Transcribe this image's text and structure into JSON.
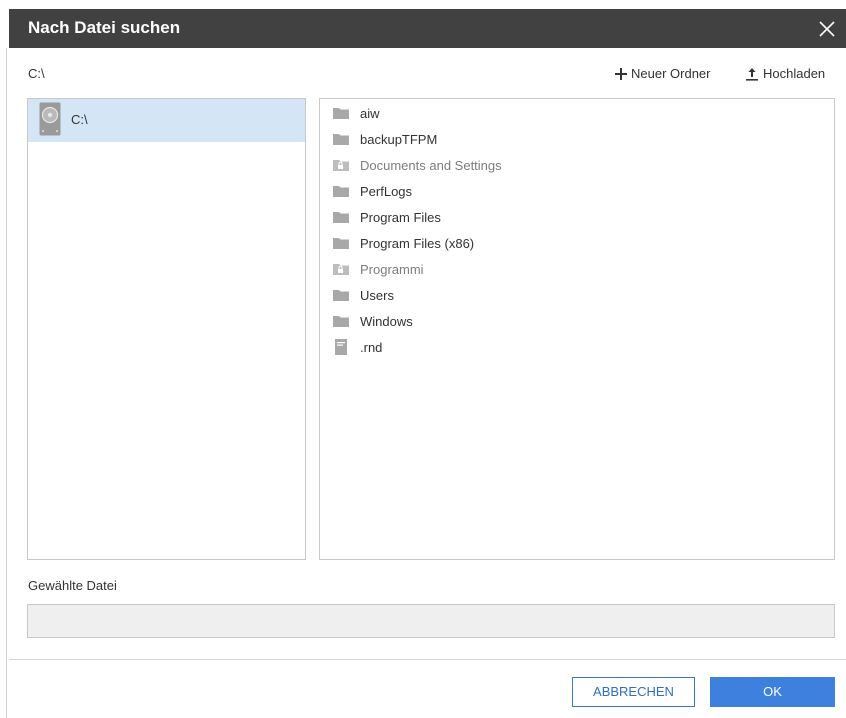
{
  "dialog": {
    "title": "Nach Datei suchen"
  },
  "toolbar": {
    "current_path": "C:\\",
    "new_folder_label": "Neuer Ordner",
    "upload_label": "Hochladen"
  },
  "tree": {
    "items": [
      {
        "label": "C:\\",
        "icon": "drive-icon",
        "selected": true
      }
    ]
  },
  "files": [
    {
      "name": "aiw",
      "icon": "folder-icon",
      "locked": false
    },
    {
      "name": "backupTFPM",
      "icon": "folder-icon",
      "locked": false
    },
    {
      "name": "Documents and Settings",
      "icon": "locked-folder-icon",
      "locked": true
    },
    {
      "name": "PerfLogs",
      "icon": "folder-icon",
      "locked": false
    },
    {
      "name": "Program Files",
      "icon": "folder-icon",
      "locked": false
    },
    {
      "name": "Program Files (x86)",
      "icon": "folder-icon",
      "locked": false
    },
    {
      "name": "Programmi",
      "icon": "locked-folder-icon",
      "locked": true
    },
    {
      "name": "Users",
      "icon": "folder-icon",
      "locked": false
    },
    {
      "name": "Windows",
      "icon": "folder-icon",
      "locked": false
    },
    {
      "name": ".rnd",
      "icon": "file-icon",
      "locked": false
    }
  ],
  "selection": {
    "label": "Gewählte Datei",
    "value": ""
  },
  "buttons": {
    "cancel": "ABBRECHEN",
    "ok": "OK"
  },
  "colors": {
    "titlebar": "#414141",
    "selected_row": "#d4e6f5",
    "primary": "#3d80dd",
    "folder": "#a8a8a8"
  }
}
